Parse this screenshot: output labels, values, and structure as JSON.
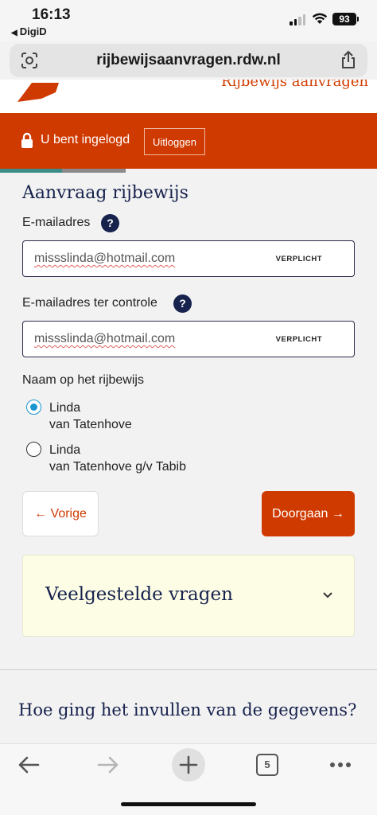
{
  "status_bar": {
    "time": "16:13",
    "back_app": "DigiD",
    "battery": "93"
  },
  "browser": {
    "url": "rijbewijsaanvragen.rdw.nl",
    "tab_count": "5"
  },
  "page": {
    "header_title_cut": "Rijbewijs aanvragen",
    "logged_in_text": "U bent ingelogd",
    "logout_label": "Uitloggen",
    "progress_fraction": 0.33,
    "heading": "Aanvraag rijbewijs",
    "email_label": "E-mailadres",
    "email_value": "missslinda@hotmail.com",
    "email_required": "VERPLICHT",
    "email_confirm_label": "E-mailadres ter controle",
    "email_confirm_value": "missslinda@hotmail.com",
    "email_confirm_required": "VERPLICHT",
    "help_symbol": "?",
    "name_label": "Naam op het rijbewijs",
    "name_options": [
      {
        "line1": "Linda",
        "line2": "van Tatenhove",
        "selected": true
      },
      {
        "line1": "Linda",
        "line2": "van Tatenhove g/v Tabib",
        "selected": false
      }
    ],
    "prev_label": "Vorige",
    "next_label": "Doorgaan",
    "faq_title": "Veelgestelde vragen",
    "feedback_title": "Hoe ging het invullen van de gegevens?"
  },
  "colors": {
    "brand_red": "#cf3a00",
    "navy": "#17224d",
    "teal_progress": "#3d8c87",
    "radio_blue": "#1a95cf",
    "faq_bg": "#fdfde6"
  },
  "icons": [
    "lens-icon",
    "share-icon",
    "lock-icon",
    "help-icon",
    "arrow-left-icon",
    "arrow-right-icon",
    "chevron-down-icon",
    "back-icon",
    "forward-icon",
    "plus-icon",
    "tabs-icon",
    "more-icon"
  ]
}
